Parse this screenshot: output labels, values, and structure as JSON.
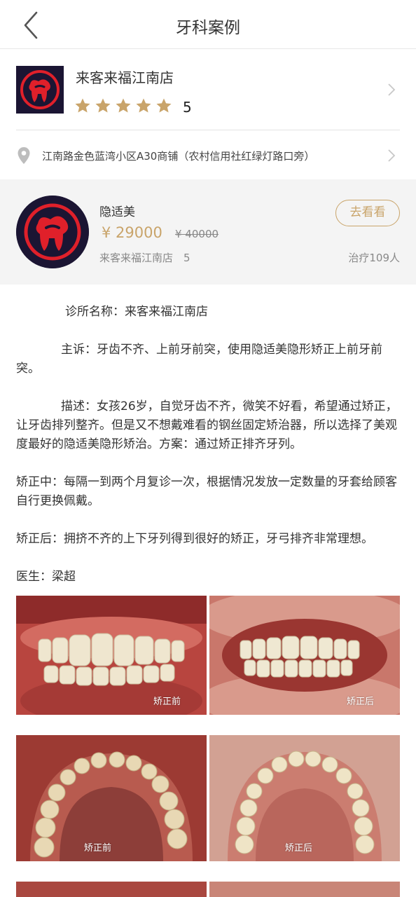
{
  "nav": {
    "title": "牙科案例"
  },
  "shop": {
    "name": "来客来福江南店",
    "rating": "5",
    "address": "江南路金色蓝湾小区A30商铺（农村信用社红绿灯路口旁）"
  },
  "product": {
    "name": "隐适美",
    "price": "¥ 29000",
    "original_price": "¥ 40000",
    "shop_info": "来客来福江南店　5",
    "go_button": "去看看",
    "treated": "治疗109人"
  },
  "article": {
    "clinic": "诊所名称：来客来福江南店",
    "complaint": "主诉：牙齿不齐、上前牙前突，使用隐适美隐形矫正上前牙前突。",
    "description": "描述：女孩26岁，自觉牙齿不齐，微笑不好看，希望通过矫正，让牙齿排列整齐。但是又不想戴难看的钢丝固定矫治器，所以选择了美观度最好的隐适美隐形矫治。方案：通过矫正排齐牙列。",
    "during": "矫正中：每隔一到两个月复诊一次，根据情况发放一定数量的牙套给顾客自行更换佩戴。",
    "after": "矫正后：拥挤不齐的上下牙列得到很好的矫正，牙弓排齐非常理想。",
    "doctor": "医生：梁超"
  },
  "photos": {
    "before_label": "矫正前",
    "after_label": "矫正后"
  },
  "colors": {
    "accent": "#c9a46a",
    "logo_bg": "#1b1533",
    "logo_red": "#e0202a"
  }
}
